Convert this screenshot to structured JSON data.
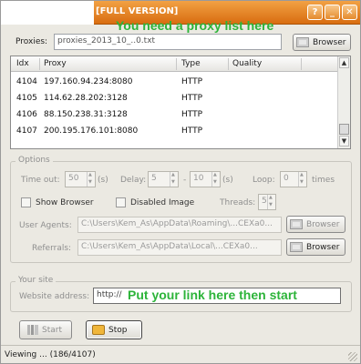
{
  "window": {
    "title": "[FULL VERSION]",
    "help_glyph": "?",
    "minimize_glyph": "_",
    "close_glyph": "✕"
  },
  "annotations": {
    "proxy_hint": "You need a proxy list here",
    "link_hint": "Put your link here then start"
  },
  "proxies": {
    "label": "Proxies:",
    "file_value": "proxies_2013_10_..0.txt",
    "browse_label": "Browser"
  },
  "table": {
    "columns": [
      "Idx",
      "Proxy",
      "Type",
      "Quality"
    ],
    "rows": [
      {
        "idx": "4104",
        "proxy": "197.160.94.234:8080",
        "type": "HTTP",
        "quality": ""
      },
      {
        "idx": "4105",
        "proxy": "114.62.28.202:3128",
        "type": "HTTP",
        "quality": ""
      },
      {
        "idx": "4106",
        "proxy": "88.150.238.31:3128",
        "type": "HTTP",
        "quality": ""
      },
      {
        "idx": "4107",
        "proxy": "200.195.176.101:8080",
        "type": "HTTP",
        "quality": ""
      }
    ]
  },
  "options": {
    "group_title": "Options",
    "timeout_label": "Time out:",
    "timeout_value": "50",
    "timeout_unit": "(s)",
    "delay_label": "Delay:",
    "delay_from": "5",
    "delay_sep": "-",
    "delay_to": "10",
    "delay_unit": "(s)",
    "loop_label": "Loop:",
    "loop_value": "0",
    "loop_unit": "times",
    "show_browser_label": "Show Browser",
    "disabled_image_label": "Disabled Image",
    "threads_label": "Threads:",
    "threads_value": "5",
    "user_agents_label": "User Agents:",
    "user_agents_value": "C:\\Users\\Kem_As\\AppData\\Roaming\\...CEXa0...",
    "referrals_label": "Referrals:",
    "referrals_value": "C:\\Users\\Kem_As\\AppData\\Local\\...CEXa0...",
    "browse_label": "Browser"
  },
  "site": {
    "group_title": "Your site",
    "address_label": "Website address:",
    "address_value": "http://"
  },
  "actions": {
    "start_label": "Start",
    "stop_label": "Stop"
  },
  "status": {
    "text": "Viewing ... (186/4107)"
  }
}
